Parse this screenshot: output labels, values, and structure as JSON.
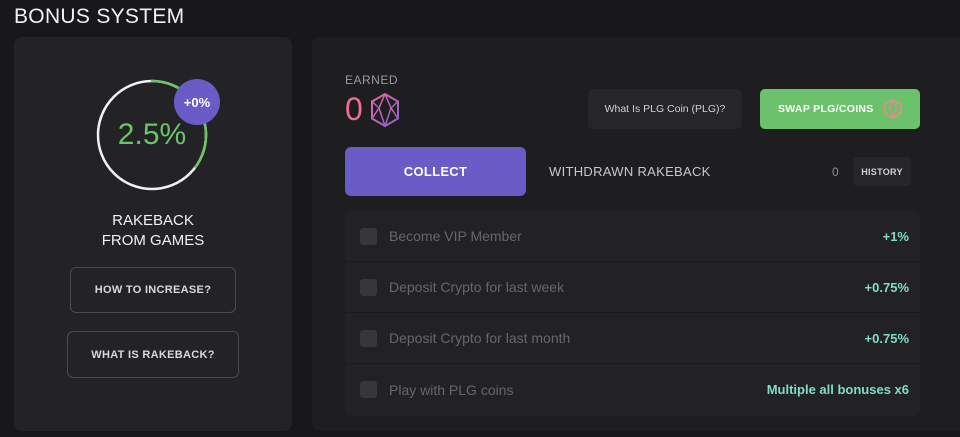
{
  "page": {
    "title": "BONUS SYSTEM"
  },
  "rakeback": {
    "percent": "2.5%",
    "ring_fill_fraction": 0.35,
    "badge": "+0%",
    "label_line1": "RAKEBACK",
    "label_line2": "FROM GAMES",
    "how_to_increase_label": "HOW TO INCREASE?",
    "what_is_label": "WHAT IS RAKEBACK?"
  },
  "earned": {
    "label": "EARNED",
    "value": "0",
    "plg_info_label": "What Is PLG Coin (PLG)?",
    "swap_label": "SWAP PLG/COINS",
    "coin_icon": "plg-coin-icon"
  },
  "collect": {
    "collect_label": "COLLECT",
    "withdrawn_label": "WITHDRAWN RAKEBACK",
    "withdrawn_value": "0",
    "history_label": "HISTORY"
  },
  "bonuses": [
    {
      "label": "Become VIP Member",
      "value": "+1%"
    },
    {
      "label": "Deposit Crypto for last week",
      "value": "+0.75%"
    },
    {
      "label": "Deposit Crypto for last month",
      "value": "+0.75%"
    },
    {
      "label": "Play with PLG coins",
      "value": "Multiple all bonuses x6"
    }
  ],
  "colors": {
    "accent_purple": "#6a5cc7",
    "accent_green": "#6cc16c",
    "earned_pink": "#ec6d92",
    "bonus_teal": "#7fdcc8"
  }
}
